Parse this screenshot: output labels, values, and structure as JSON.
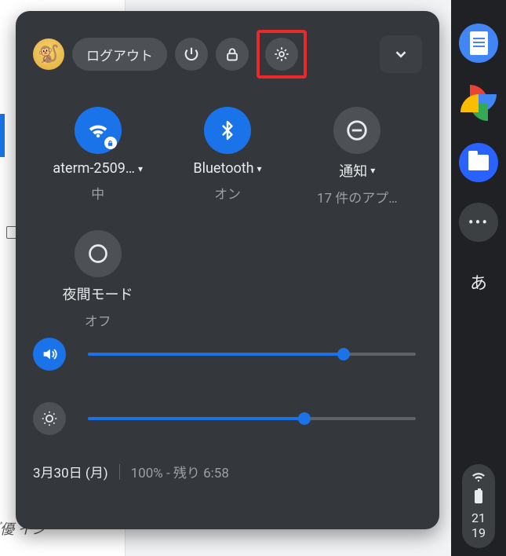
{
  "header": {
    "logout_label": "ログアウト"
  },
  "tiles": {
    "wifi": {
      "label": "aterm-2509…",
      "sub": "中"
    },
    "bluetooth": {
      "label": "Bluetooth",
      "sub": "オン"
    },
    "notif": {
      "label": "通知",
      "sub": "17 件のアプ…"
    },
    "night": {
      "label": "夜間モード",
      "sub": "オフ"
    }
  },
  "sliders": {
    "volume": {
      "percent": 78
    },
    "brightness": {
      "percent": 66
    }
  },
  "footer": {
    "date": "3月30日 (月)",
    "battery": "100% - 残り 6:58"
  },
  "shelf": {
    "ime": "あ",
    "more": "•••",
    "time": {
      "hh": "21",
      "mm": "19"
    }
  },
  "bg": {
    "text": "゙優\nイン"
  }
}
